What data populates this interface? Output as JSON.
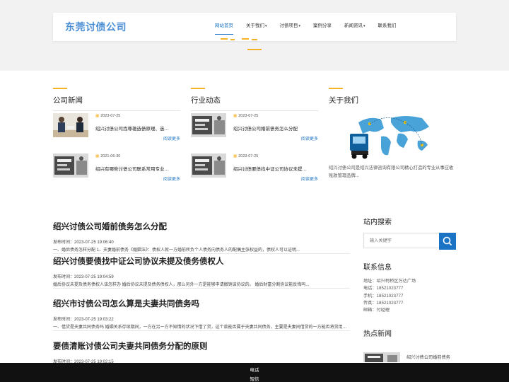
{
  "header": {
    "logo": "东莞讨债公司",
    "menu": [
      {
        "label": "网站首页",
        "caret": false,
        "active": true
      },
      {
        "label": "关于我们",
        "caret": true,
        "active": false
      },
      {
        "label": "讨债项目",
        "caret": true,
        "active": false
      },
      {
        "label": "案例分享",
        "caret": false,
        "active": false
      },
      {
        "label": "新闻资讯",
        "caret": true,
        "active": false
      },
      {
        "label": "联系我们",
        "caret": false,
        "active": false
      }
    ]
  },
  "sections": {
    "company_news": {
      "title": "公司新闻",
      "items": [
        {
          "date": "2023-07-25",
          "title": "绍兴讨债公司找尊雄选债原理、选…",
          "more": "阅读更多"
        },
        {
          "date": "2021-06-30",
          "title": "绍兴有哪些讨债公司联系常用专业…",
          "more": "阅读更多"
        }
      ]
    },
    "industry_news": {
      "title": "行业动态",
      "items": [
        {
          "date": "2023-07-25",
          "title": "绍兴讨债公司婚前债务怎么分配",
          "more": "阅读更多"
        },
        {
          "date": "2023-07-25",
          "title": "绍兴讨债要债找中证公司协议未提…",
          "more": "阅读更多"
        }
      ]
    },
    "about": {
      "title": "关于我们",
      "text": "绍兴讨债公司是绍兴法律咨询有限公司精心打造的专业从事应收账款管理品牌..."
    }
  },
  "articles": [
    {
      "title": "绍兴讨债公司婚前债务怎么分配",
      "time": "发布时间：2023-07-25 19:06:40",
      "summary": "一、婚后债务怎样分配 1、夫妻婚前债务《婚姻法》：债权人就一方婚前所负个人债务向债务人的配偶主张权益的，债权人可以证明..."
    },
    {
      "title": "绍兴讨债要债找中证公司协议未提及债务债权人",
      "time": "发布时间：2023-07-25 19:04:59",
      "summary": "婚后协议未提及债务债权人该怎样办 婚后协议未提及债务债权人，那么另外一方是能够申请撤销该协议的。 婚后财富分割协议能反悔吗..."
    },
    {
      "title": "绍兴市讨债公司怎么算是夫妻共同债务吗",
      "time": "发布时间：2023-07-25 19:03:22",
      "summary": "一、借贷是夫妻共同债务吗 婚姻关系存续期间，一方在另一方不知情的状况下借了贷，这个款能否属于夫妻共同债务，主要是夫妻间借贷的一方能否将贷用于家庭生活..."
    },
    {
      "title": "要债清账讨债公司夫妻共同债务分配的原则",
      "time": "发布时间：2023-07-25 19:02:15",
      "summary": ""
    }
  ],
  "sidebar": {
    "search": {
      "title": "站内搜索",
      "placeholder": "输入关键字"
    },
    "contact": {
      "title": "联系信息",
      "lines": [
        "地址：绍兴柯桥区万达广场",
        "电话：18521023777",
        "手机：18521023777",
        "传真：18521023777",
        "邮箱：付经理"
      ]
    },
    "hot": {
      "title": "热点新闻",
      "items": [
        "绍兴讨债公司婚前债务"
      ]
    }
  },
  "footer": {
    "phone": "电话",
    "sms": "短信"
  },
  "colors": {
    "accent": "#1a73c4",
    "gold": "#f5b323",
    "logo": "#4a8fd6",
    "footer": "#111111"
  }
}
